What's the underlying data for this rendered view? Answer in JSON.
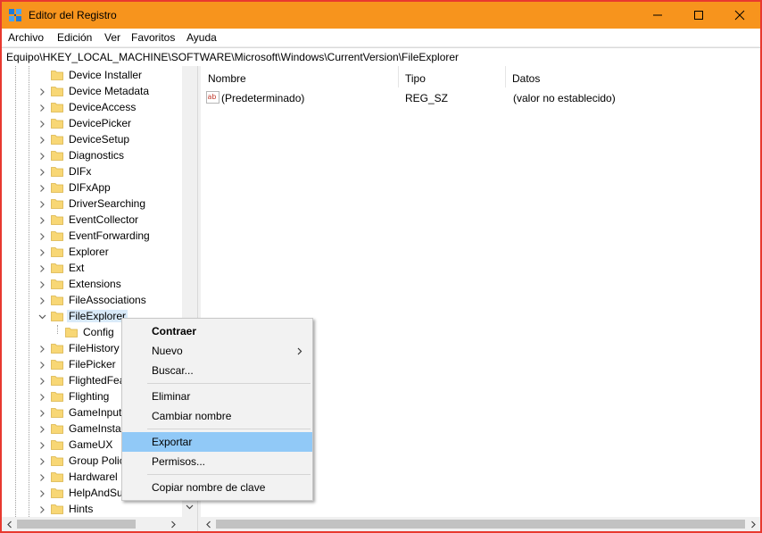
{
  "window": {
    "title": "Editor del Registro"
  },
  "menu": [
    "Archivo",
    "Edición",
    "Ver",
    "Favoritos",
    "Ayuda"
  ],
  "address": "Equipo\\HKEY_LOCAL_MACHINE\\SOFTWARE\\Microsoft\\Windows\\CurrentVersion\\FileExplorer",
  "tree": {
    "items": [
      "Device Installer",
      "Device Metadata",
      "DeviceAccess",
      "DevicePicker",
      "DeviceSetup",
      "Diagnostics",
      "DIFx",
      "DIFxApp",
      "DriverSearching",
      "EventCollector",
      "EventForwarding",
      "Explorer",
      "Ext",
      "Extensions",
      "FileAssociations",
      "FileExplorer",
      "Config",
      "FileHistory",
      "FilePicker",
      "FlightedFea",
      "Flighting",
      "GameInput",
      "GameInstal",
      "GameUX",
      "Group Polic",
      "Hardwarel",
      "HelpAndSu",
      "Hints"
    ]
  },
  "list": {
    "headers": [
      "Nombre",
      "Tipo",
      "Datos"
    ],
    "rows": [
      {
        "name": "(Predeterminado)",
        "type": "REG_SZ",
        "data": "(valor no establecido)"
      }
    ]
  },
  "context_menu": {
    "items": [
      "Contraer",
      "Nuevo",
      "Buscar...",
      "Eliminar",
      "Cambiar nombre",
      "Exportar",
      "Permisos...",
      "Copiar nombre de clave"
    ]
  },
  "colors": {
    "titlebar": "#f7941d",
    "border": "#e8392f",
    "highlight": "#91c9f7",
    "folder": "#f8d775"
  }
}
